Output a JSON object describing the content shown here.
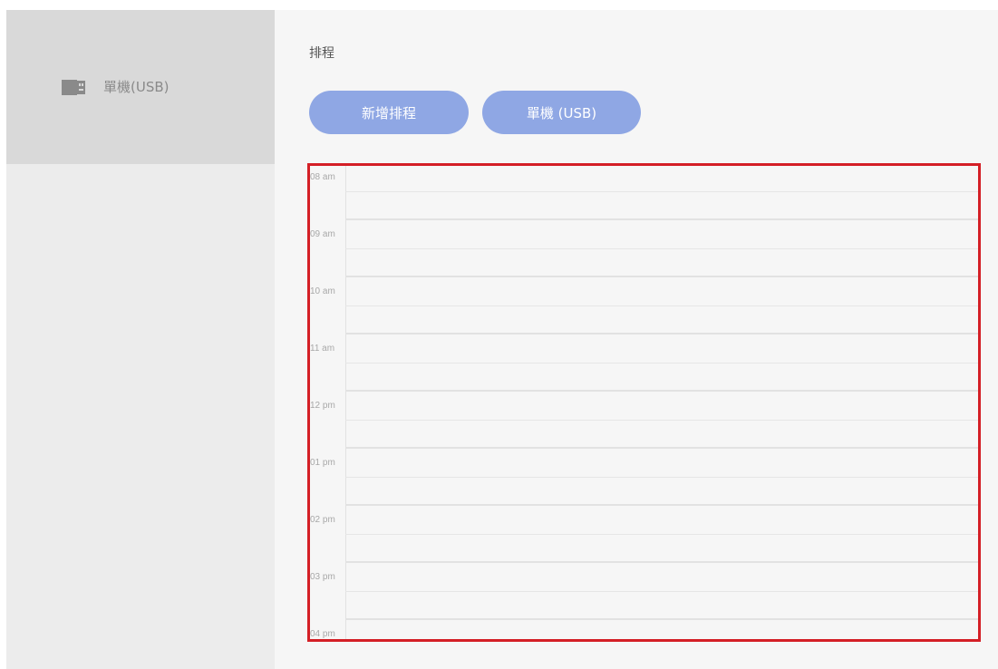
{
  "sidebar": {
    "items": [
      {
        "label": "單機(USB)",
        "icon": "usb-drive-icon"
      }
    ]
  },
  "main": {
    "title": "排程",
    "buttons": {
      "add_schedule": "新增排程",
      "standalone_usb": "單機 (USB)"
    }
  },
  "calendar": {
    "hours": [
      "08 am",
      "09 am",
      "10 am",
      "11 am",
      "12 pm",
      "01 pm",
      "02 pm",
      "03 pm",
      "04 pm"
    ]
  },
  "colors": {
    "accent": "#8fa7e4",
    "highlight_border": "#d41f26",
    "sidebar_selected": "#d9d9d9",
    "sidebar_bg": "#ececec",
    "main_bg": "#f6f6f6"
  }
}
